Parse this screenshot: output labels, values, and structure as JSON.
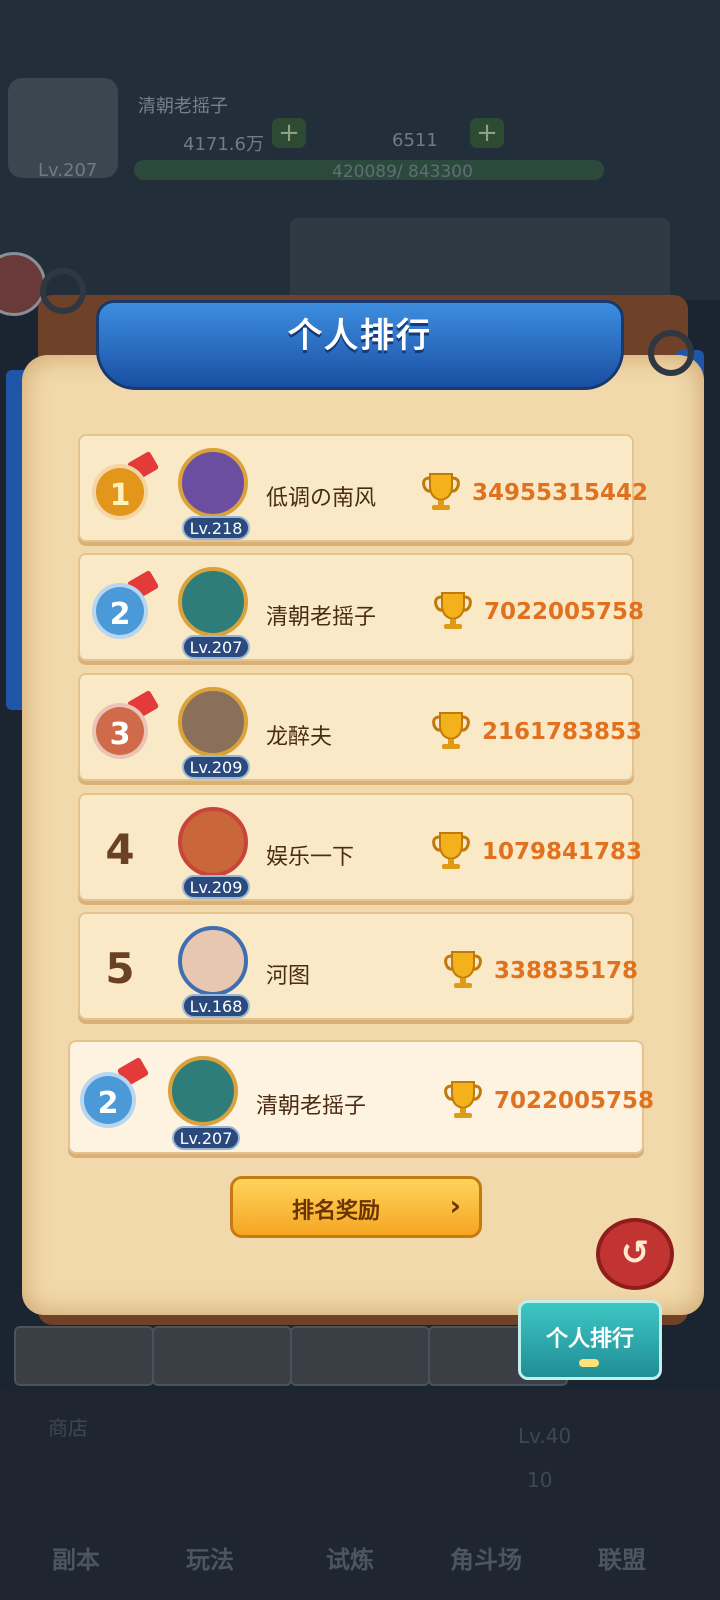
{
  "hud": {
    "player_name": "清朝老摇子",
    "level": "Lv.207",
    "gold": "4171.6万",
    "gems": "6511",
    "exp": "420089/ 843300",
    "plus": "+"
  },
  "panel": {
    "title": "个人排行",
    "reward_button": "排名奖励",
    "reward_arrow": "›",
    "close_symbol": "↺",
    "tab_label": "个人排行"
  },
  "rankings": [
    {
      "rank": "1",
      "medal": "gold",
      "name": "低调の南风",
      "level": "Lv.218",
      "score": "34955315442"
    },
    {
      "rank": "2",
      "medal": "silver",
      "name": "清朝老摇子",
      "level": "Lv.207",
      "score": "7022005758"
    },
    {
      "rank": "3",
      "medal": "bronze",
      "name": "龙醉夫",
      "level": "Lv.209",
      "score": "2161783853"
    },
    {
      "rank": "4",
      "medal": "",
      "name": "娱乐一下",
      "level": "Lv.209",
      "score": "1079841783"
    },
    {
      "rank": "5",
      "medal": "",
      "name": "河图",
      "level": "Lv.168",
      "score": "338835178"
    }
  ],
  "my_rank": {
    "rank": "2",
    "medal": "silver",
    "name": "清朝老摇子",
    "level": "Lv.207",
    "score": "7022005758"
  },
  "bottom_nav": {
    "shop": "商店",
    "dungeon": "副本",
    "gameplay": "玩法",
    "trial": "试炼",
    "arena": "角斗场",
    "guild": "联盟",
    "arena_badge": "10",
    "level_tag": "Lv.40"
  },
  "colors": {
    "score": "#e0711f",
    "banner": "#1f56a8",
    "paper": "#f2d9ab"
  }
}
